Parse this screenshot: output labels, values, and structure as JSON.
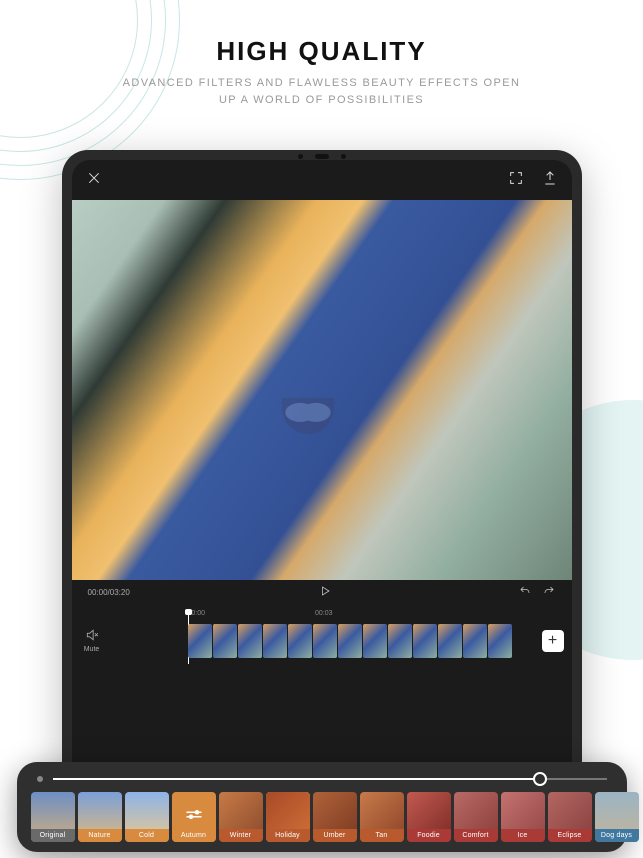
{
  "marketing": {
    "title": "HIGH QUALITY",
    "subtitle_l1": "ADVANCED FILTERS AND FLAWLESS BEAUTY EFFECTS OPEN",
    "subtitle_l2": "UP A WORLD OF POSSIBILITIES"
  },
  "editor": {
    "time_current": "00:00",
    "time_total": "03:20",
    "time_display": "00:00/03:20",
    "mute_label": "Mute",
    "ruler": [
      "00:00",
      "00:03"
    ],
    "add_label": "+"
  },
  "slider": {
    "percent": 88
  },
  "filters": [
    {
      "name": "Original",
      "tint": "linear-gradient(#6d8fc4,#cfae80)",
      "label_bg": "#6a6a6a"
    },
    {
      "name": "Nature",
      "tint": "linear-gradient(#7aa0d8,#e0b97e)",
      "label_bg": "#d88a3e"
    },
    {
      "name": "Cold",
      "tint": "linear-gradient(#8db4e8,#e8c790)",
      "label_bg": "#d88a3e"
    },
    {
      "name": "Autumn",
      "tint": "linear-gradient(#d88a3e,#d88a3e)",
      "label_bg": "#d88a3e",
      "icon": true
    },
    {
      "name": "Winter",
      "tint": "linear-gradient(135deg,#c77a46,#8a4a2c)",
      "label_bg": "#b85a2e"
    },
    {
      "name": "Holiday",
      "tint": "linear-gradient(135deg,#a84a28,#d07038)",
      "label_bg": "#b85a2e",
      "selected": true
    },
    {
      "name": "Umber",
      "tint": "linear-gradient(135deg,#b0623a,#7a3a20)",
      "label_bg": "#b85a2e"
    },
    {
      "name": "Tan",
      "tint": "linear-gradient(135deg,#c87a4a,#8c4428)",
      "label_bg": "#b85a2e"
    },
    {
      "name": "Foodie",
      "tint": "linear-gradient(135deg,#c25a50,#7a2a24)",
      "label_bg": "#aa3a36"
    },
    {
      "name": "Comfort",
      "tint": "linear-gradient(135deg,#b86a66,#8a3c3a)",
      "label_bg": "#aa3a36"
    },
    {
      "name": "Ice",
      "tint": "linear-gradient(135deg,#c47270,#924644)",
      "label_bg": "#aa3a36"
    },
    {
      "name": "Eclipse",
      "tint": "linear-gradient(135deg,#b46662,#86403e)",
      "label_bg": "#aa3a36"
    },
    {
      "name": "Dog days",
      "tint": "linear-gradient(#9ab4c4,#c4b49a)",
      "label_bg": "#4078a0"
    }
  ]
}
